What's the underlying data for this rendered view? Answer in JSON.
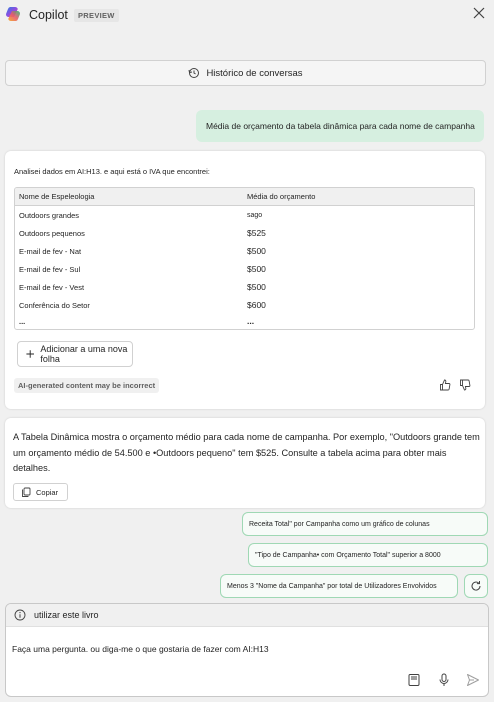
{
  "app": {
    "title": "Copilot",
    "badge": "PREVIEW"
  },
  "history_button": {
    "label": "Histórico de conversas"
  },
  "user_message": "Média de orçamento da tabela dinâmica para cada nome de campanha",
  "response": {
    "intro": "Analisei dados em AI:H13. e aqui está o IVA que encontrei:",
    "table": {
      "headers": [
        "Nome de Espeleologia",
        "Média do orçamento"
      ],
      "rows": [
        [
          "Outdoors grandes",
          "sago"
        ],
        [
          "Outdoors pequenos",
          "$525"
        ],
        [
          "E-mail de fev - Nat",
          "$500"
        ],
        [
          "E-mail de fev - Sul",
          "$500"
        ],
        [
          "E-mail de fev - Vest",
          "$500"
        ],
        [
          "Conferência do Setor",
          "$600"
        ],
        [
          "...",
          "..."
        ]
      ]
    },
    "add_sheet_label": "Adicionar a uma nova folha",
    "ai_disclaimer": "AI-generated content may be incorrect"
  },
  "summary": {
    "text": "A Tabela Dinâmica mostra o orçamento médio para cada nome de campanha. Por exemplo, \"Outdoors grande tem um orçamento médio de 54.500 e •Outdoors pequeno\" tem $525. Consulte a tabela acima para obter mais detalhes.",
    "copy_label": "Copiar"
  },
  "suggestions": [
    "Receita Total\" por Campanha como um gráfico de colunas",
    "\"Tipo de Campanha• com Orçamento Total\" superior a 8000",
    "Menos 3 \"Nome da Campanha\" por total de Utilizadores Envolvidos"
  ],
  "input": {
    "context_label": "utilizar este livro",
    "placeholder": "Faça uma pergunta. ou diga-me o que gostaria de fazer com AI:H13"
  },
  "colors": {
    "accent_green": "#9fd8b4",
    "user_bubble": "#d6efe0"
  }
}
